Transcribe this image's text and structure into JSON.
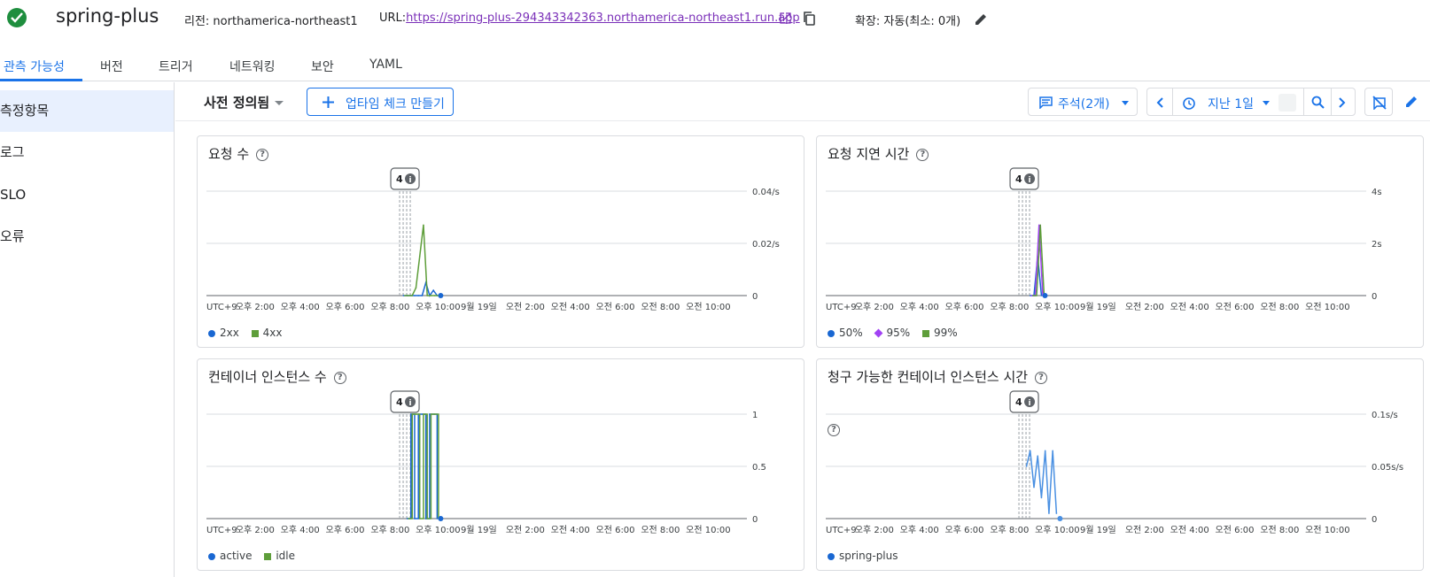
{
  "header": {
    "service_name": "spring-plus",
    "region_label": "리전: northamerica-northeast1",
    "url_label": "URL:",
    "url": "https://spring-plus-294343342363.northamerica-northeast1.run.app",
    "scaling_label": "확장: 자동(최소: 0개)",
    "status_color": "#1e8e3e"
  },
  "tabs": [
    {
      "label": "관측 가능성",
      "active": true
    },
    {
      "label": "버전"
    },
    {
      "label": "트리거"
    },
    {
      "label": "네트워킹"
    },
    {
      "label": "보안"
    },
    {
      "label": "YAML"
    }
  ],
  "sidebar": {
    "items": [
      {
        "label": "측정항목",
        "active": true
      },
      {
        "label": "로그"
      },
      {
        "label": "SLO"
      },
      {
        "label": "오류"
      }
    ]
  },
  "toolbar": {
    "predefined_label": "사전 정의됨",
    "uptime_button": "업타임 체크 만들기",
    "annotations_button": "주석(2개)",
    "time_range": "지난 1일"
  },
  "accent_color": "#1a73e8",
  "annotation_badge": "4",
  "x_axis_ticks": [
    "UTC+9",
    "오후 2:00",
    "오후 4:00",
    "오후 6:00",
    "오후 8:00",
    "오후 10:00",
    "9월 19일",
    "오전 2:00",
    "오전 4:00",
    "오전 6:00",
    "오전 8:00",
    "오전 10:00"
  ],
  "charts": {
    "requests": {
      "title": "요청 수",
      "y_ticks": [
        "0.04/s",
        "0.02/s",
        "0"
      ],
      "legend": [
        {
          "name": "2xx",
          "color": "#1967d2"
        },
        {
          "name": "4xx",
          "color": "#5e9e3a"
        }
      ]
    },
    "latency": {
      "title": "요청 지연 시간",
      "y_ticks": [
        "4s",
        "2s",
        "0"
      ],
      "legend": [
        {
          "name": "50%",
          "color": "#1967d2"
        },
        {
          "name": "95%",
          "color": "#a142f4"
        },
        {
          "name": "99%",
          "color": "#5e9e3a"
        }
      ]
    },
    "instances": {
      "title": "컨테이너 인스턴스 수",
      "y_ticks": [
        "1",
        "0.5",
        "0"
      ],
      "legend": [
        {
          "name": "active",
          "color": "#1967d2"
        },
        {
          "name": "idle",
          "color": "#5e9e3a"
        }
      ]
    },
    "billable": {
      "title": "청구 가능한 컨테이너 인스턴스 시간",
      "y_ticks": [
        "0.1s/s",
        "0.05s/s",
        "0"
      ],
      "legend": [
        {
          "name": "spring-plus",
          "color": "#1967d2"
        }
      ]
    }
  },
  "chart_data": [
    {
      "type": "line",
      "title": "요청 수",
      "x": [
        "오후 8:40",
        "오후 8:50",
        "오후 9:00",
        "오후 9:10",
        "오후 9:20",
        "오후 9:30",
        "오후 9:40",
        "오후 9:50",
        "오후 10:00",
        "오후 10:10"
      ],
      "series": [
        {
          "name": "2xx",
          "values": [
            0,
            0,
            0,
            0,
            0,
            0,
            0.005,
            0,
            0.002,
            0
          ]
        },
        {
          "name": "4xx",
          "values": [
            0,
            0,
            0,
            0.003,
            0.015,
            0.027,
            0,
            0,
            0,
            0
          ]
        }
      ],
      "ylim": [
        0,
        0.04
      ]
    },
    {
      "type": "line",
      "title": "요청 지연 시간",
      "x": [
        "오후 9:00",
        "오후 9:10",
        "오후 9:20",
        "오후 9:30"
      ],
      "series": [
        {
          "name": "50%",
          "values": [
            0,
            0,
            1.5,
            0
          ]
        },
        {
          "name": "95%",
          "values": [
            0,
            0,
            2.7,
            0
          ]
        },
        {
          "name": "99%",
          "values": [
            0,
            0,
            2.7,
            0
          ]
        }
      ],
      "ylim": [
        0,
        4
      ]
    },
    {
      "type": "line",
      "title": "컨테이너 인스턴스 수",
      "x": [
        "오후 8:50",
        "오후 9:00",
        "오후 9:10",
        "오후 9:20",
        "오후 9:30",
        "오후 9:40",
        "오후 9:50",
        "오후 10:00",
        "오후 10:10"
      ],
      "series": [
        {
          "name": "active",
          "values": [
            0,
            1,
            0,
            1,
            1,
            0,
            1,
            1,
            0
          ]
        },
        {
          "name": "idle",
          "values": [
            0,
            1,
            1,
            0,
            1,
            0,
            1,
            1,
            0
          ]
        }
      ],
      "ylim": [
        0,
        1
      ]
    },
    {
      "type": "line",
      "title": "청구 가능한 컨테이너 인스턴스 시간",
      "x": [
        "오후 8:50",
        "오후 9:00",
        "오후 9:10",
        "오후 9:20",
        "오후 9:30",
        "오후 9:40",
        "오후 9:50",
        "오후 10:00",
        "오후 10:10"
      ],
      "series": [
        {
          "name": "spring-plus",
          "values": [
            0.05,
            0.065,
            0.03,
            0.06,
            0.02,
            0.065,
            0.005,
            0.065,
            0.005
          ]
        }
      ],
      "ylim": [
        0,
        0.1
      ]
    }
  ]
}
